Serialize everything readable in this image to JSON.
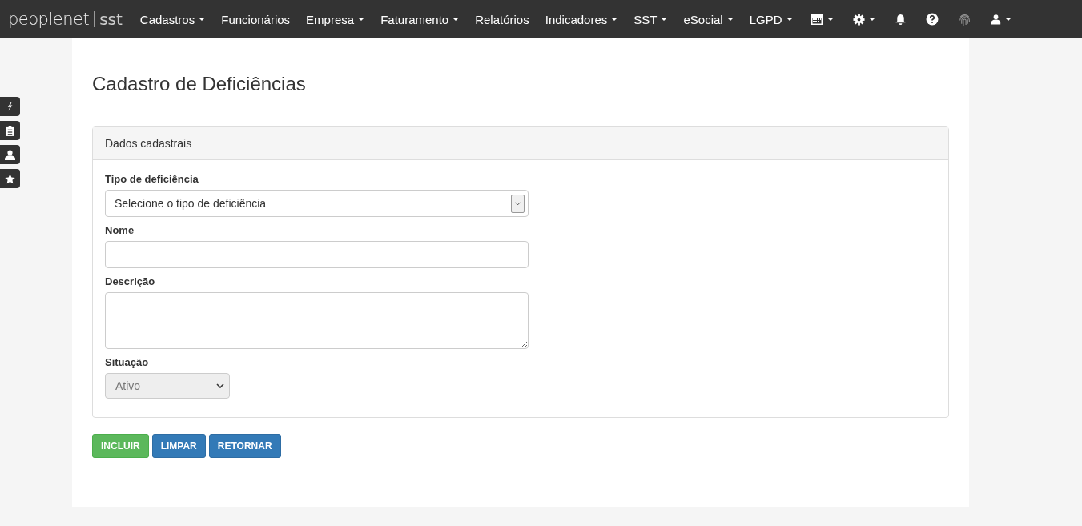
{
  "navbar": {
    "logo": {
      "brand": "peoplenet",
      "product": "sst"
    },
    "menu": [
      {
        "kind": "text",
        "label": "Cadastros",
        "dropdown": true
      },
      {
        "kind": "text",
        "label": "Funcionários",
        "dropdown": false
      },
      {
        "kind": "text",
        "label": "Empresa",
        "dropdown": true
      },
      {
        "kind": "text",
        "label": "Faturamento",
        "dropdown": true
      },
      {
        "kind": "text",
        "label": "Relatórios",
        "dropdown": false
      },
      {
        "kind": "text",
        "label": "Indicadores",
        "dropdown": true
      },
      {
        "kind": "text",
        "label": "SST",
        "dropdown": true
      },
      {
        "kind": "text",
        "label": "eSocial",
        "dropdown": true
      },
      {
        "kind": "text",
        "label": "LGPD",
        "dropdown": true
      },
      {
        "kind": "calendar",
        "dropdown": true
      },
      {
        "kind": "gear",
        "dropdown": true
      },
      {
        "kind": "bell",
        "dropdown": false
      },
      {
        "kind": "help",
        "dropdown": false
      },
      {
        "kind": "fingerprint",
        "dropdown": false
      },
      {
        "kind": "user",
        "dropdown": true
      }
    ]
  },
  "side_tabs": [
    {
      "kind": "bolt"
    },
    {
      "kind": "clipboard"
    },
    {
      "kind": "user"
    },
    {
      "kind": "star"
    }
  ],
  "page_title": "Cadastro de Deficiências",
  "panel": {
    "heading": "Dados cadastrais",
    "fields": [
      {
        "kind": "select",
        "label": "Tipo de deficiência",
        "value": "Selecione o tipo de deficiência",
        "disabled": false
      },
      {
        "kind": "input",
        "label": "Nome"
      },
      {
        "kind": "textarea",
        "label": "Descrição"
      },
      {
        "kind": "small-select",
        "label": "Situação",
        "value": "Ativo",
        "disabled": true
      }
    ]
  },
  "buttons": [
    {
      "label": "INCLUIR",
      "kind": "success"
    },
    {
      "label": "LIMPAR",
      "kind": "primary"
    },
    {
      "label": "RETORNAR",
      "kind": "primary"
    }
  ]
}
